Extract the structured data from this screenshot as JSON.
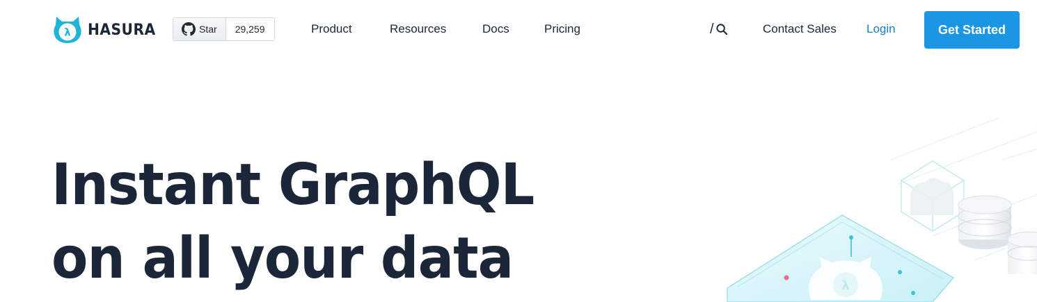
{
  "brand": {
    "name": "HASURA",
    "accent": "#1eb4d4"
  },
  "github": {
    "star_label": "Star",
    "star_count": "29,259"
  },
  "nav": {
    "links": [
      {
        "label": "Product"
      },
      {
        "label": "Resources"
      },
      {
        "label": "Docs"
      },
      {
        "label": "Pricing"
      }
    ],
    "search_label": "/",
    "contact": "Contact Sales",
    "login": "Login",
    "cta": "Get Started"
  },
  "hero": {
    "title_line1": "Instant GraphQL",
    "title_line2": "on all your data"
  },
  "colors": {
    "text": "#1b2738",
    "link_blue": "#1b7fc6",
    "cta_blue": "#1a96e5"
  },
  "icons": [
    "hasura-logo-icon",
    "github-icon",
    "search-icon"
  ]
}
